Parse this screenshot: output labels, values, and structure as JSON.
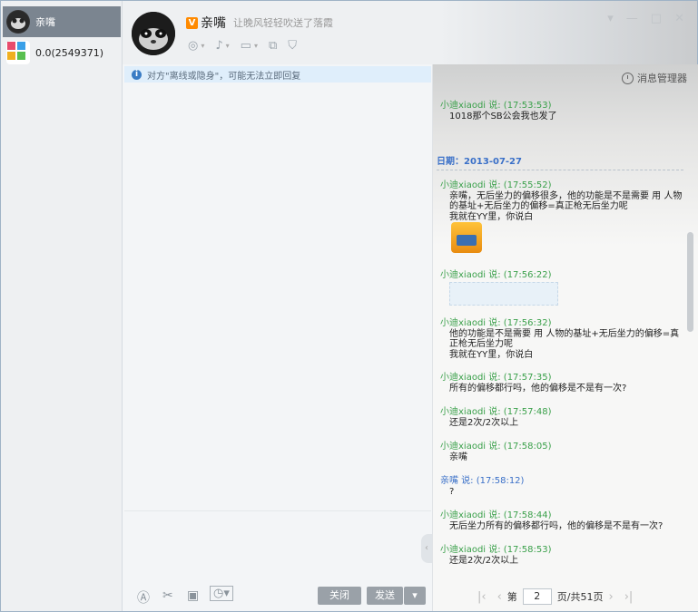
{
  "sidebar": {
    "items": [
      {
        "label": "亲嘴",
        "active": true
      },
      {
        "label": "0.0(2549371)",
        "active": false
      }
    ]
  },
  "header": {
    "vip_badge": "V",
    "contact_name": "亲嘴",
    "status": "让晚风轻轻吹送了落霞"
  },
  "notice": {
    "text": "对方\"离线或隐身\"，可能无法立即回复"
  },
  "history": {
    "manager_label": "消息管理器",
    "date_label": "日期：2013-07-27",
    "messages": [
      {
        "header": "小迪xiaodi 说: (17:53:53)",
        "body": "1018那个SB公会我也发了"
      },
      {
        "header": "小迪xiaodi 说: (17:55:52)",
        "body": "亲嘴，无后坐力的偏移很多，他的功能是不是需要  用  人物的基址+无后坐力的偏移=真正枪无后坐力呢",
        "body2": "我就在YY里，你说白"
      },
      {
        "header": "小迪xiaodi 说: (17:56:22)"
      },
      {
        "header": "小迪xiaodi 说: (17:56:32)",
        "body": "他的功能是不是需要  用  人物的基址+无后坐力的偏移=真正枪无后坐力呢",
        "body2": "我就在YY里，你说白"
      },
      {
        "header": "小迪xiaodi 说: (17:57:35)",
        "body": "所有的偏移都行吗，他的偏移是不是有一次?"
      },
      {
        "header": "小迪xiaodi 说: (17:57:48)",
        "body": "还是2次/2次以上"
      },
      {
        "header": "小迪xiaodi 说: (17:58:05)",
        "body": "亲嘴"
      },
      {
        "header": "亲嘴 说: (17:58:12)",
        "body": "?"
      },
      {
        "header": "小迪xiaodi 说: (17:58:44)",
        "body": "无后坐力所有的偏移都行吗，他的偏移是不是有一次?"
      },
      {
        "header": "小迪xiaodi 说: (17:58:53)",
        "body": "还是2次/2次以上"
      }
    ]
  },
  "bottom": {
    "close_label": "关闭",
    "send_label": "发送"
  },
  "pager": {
    "prefix": "第",
    "page": "2",
    "suffix": "页/共51页"
  }
}
